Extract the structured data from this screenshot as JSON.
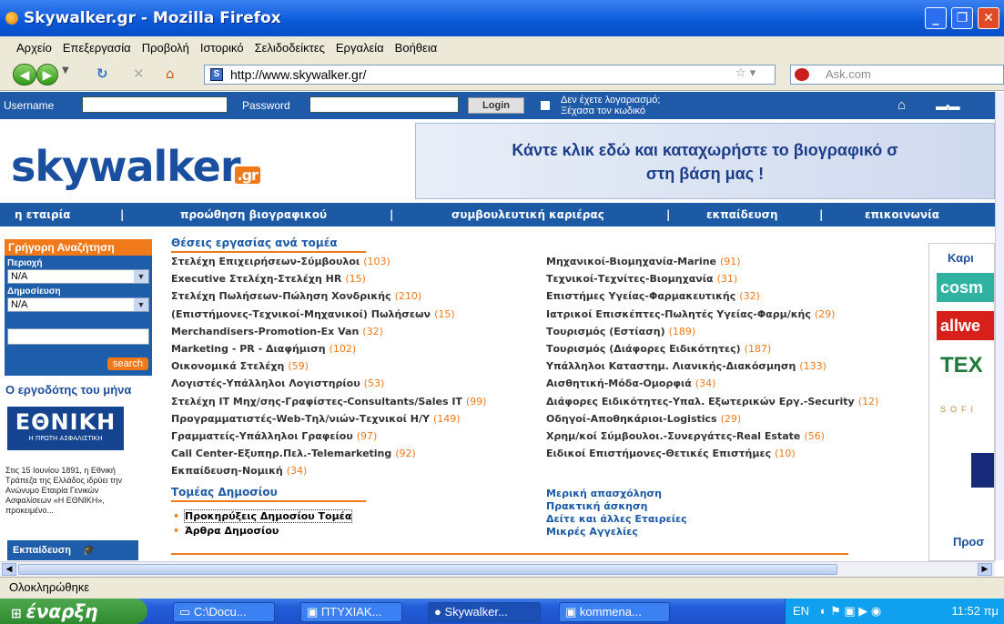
{
  "window": {
    "title": "Skywalker.gr - Mozilla Firefox"
  },
  "menu": [
    "Αρχείο",
    "Επεξεργασία",
    "Προβολή",
    "Ιστορικό",
    "Σελιδοδείκτες",
    "Εργαλεία",
    "Βοήθεια"
  ],
  "nav": {
    "url": "http://www.skywalker.gr/",
    "search_engine": "Ask.com"
  },
  "site_top": {
    "username_label": "Username",
    "password_label": "Password",
    "login_label": "Login",
    "no_account": "Δεν έχετε λογαριασμό;",
    "forgot": "Ξέχασα τον κωδικό"
  },
  "header": {
    "logo": "skywalker",
    "logo_suffix": ".gr",
    "banner_line1": "Κάντε κλικ εδώ και καταχωρήστε το βιογραφικό σ",
    "banner_line2": "στη βάση μας !"
  },
  "mainnav": [
    "η εταιρία",
    "προώθηση βιογραφικού",
    "συμβουλευτική καριέρας",
    "εκπαίδευση",
    "επικοινωνία"
  ],
  "quick_search": {
    "title": "Γρήγορη Αναζήτηση",
    "region_label": "Περιοχή",
    "region_value": "N/A",
    "published_label": "Δημοσίευση",
    "published_value": "N/A",
    "search_button": "search"
  },
  "employer": {
    "title": "Ο εργοδότης του μήνα",
    "logo_main": "ΕΘΝΙΚΗ",
    "logo_sub": "Η ΠΡΩΤΗ ΑΣΦΑΛΙΣΤΙΚΗ",
    "text": "Στις 15 Ιουνίου 1891, η Εθνική Τράπεζα της Ελλάδος ιδρύει την Ανώνυμο Εταιρία Γενικών Ασφαλίσεων «Η ΕΘΝΙΚΗ», προκειμένο..."
  },
  "education_box": "Εκπαίδευση",
  "jobs": {
    "title": "Θέσεις εργασίας ανά τομέα",
    "left": [
      {
        "label": "Στελέχη Επιχειρήσεων-Σύμβουλοι",
        "count": "(103)"
      },
      {
        "label": "Executive Στελέχη-Στελέχη HR",
        "count": "(15)"
      },
      {
        "label": "Στελέχη Πωλήσεων-Πώληση Χονδρικής",
        "count": "(210)"
      },
      {
        "label": "(Επιστήμονες-Τεχνικοί-Μηχανικοί) Πωλήσεων",
        "count": "(15)"
      },
      {
        "label": "Merchandisers-Promotion-Ex Van",
        "count": "(32)"
      },
      {
        "label": "Marketing - PR - Διαφήμιση",
        "count": "(102)"
      },
      {
        "label": "Οικονομικά Στελέχη",
        "count": "(59)"
      },
      {
        "label": "Λογιστές-Υπάλληλοι Λογιστηρίου",
        "count": "(53)"
      },
      {
        "label": "Στελέχη IT Μηχ/σης-Γραφίστες-Consultants/Sales IT",
        "count": "(99)"
      },
      {
        "label": "Προγραμματιστές-Web-Τηλ/νιών-Τεχνικοί Η/Υ",
        "count": "(149)"
      },
      {
        "label": "Γραμματείς-Υπάλληλοι Γραφείου",
        "count": "(97)"
      },
      {
        "label": "Call Center-Εξυπηρ.Πελ.-Telemarketing",
        "count": "(92)"
      },
      {
        "label": "Εκπαίδευση-Νομική",
        "count": "(34)"
      }
    ],
    "right": [
      {
        "label": "Μηχανικοί-Βιομηχανία-Marine",
        "count": "(91)"
      },
      {
        "label": "Τεχνικοί-Τεχνίτες-Βιομηχανία",
        "count": "(31)"
      },
      {
        "label": "Επιστήμες Υγείας-Φαρμακευτικής",
        "count": "(32)"
      },
      {
        "label": "Ιατρικοί Επισκέπτες-Πωλητές Υγείας-Φαρμ/κής",
        "count": "(29)"
      },
      {
        "label": "Τουρισμός (Εστίαση)",
        "count": "(189)"
      },
      {
        "label": "Τουρισμός (Διάφορες Ειδικότητες)",
        "count": "(187)"
      },
      {
        "label": "Υπάλληλοι Καταστημ. Λιανικής-Διακόσμηση",
        "count": "(133)"
      },
      {
        "label": "Αισθητική-Μόδα-Ομορφιά",
        "count": "(34)"
      },
      {
        "label": "Διάφορες Ειδικότητες-Υπαλ. Εξωτερικών Εργ.-Security",
        "count": "(12)"
      },
      {
        "label": "Οδηγοί-Αποθηκάριοι-Logistics",
        "count": "(29)"
      },
      {
        "label": "Χρημ/κοί Σύμβουλοι.-Συνεργάτες-Real Estate",
        "count": "(56)"
      },
      {
        "label": "Ειδικοί Επιστήμονες-Θετικές Επιστήμες",
        "count": "(10)"
      }
    ]
  },
  "public_sector": {
    "title": "Τομέας Δημοσίου",
    "items": [
      "Προκηρύξεις Δημοσίου Τομέα",
      "Άρθρα Δημοσίου"
    ]
  },
  "other_links": [
    "Μερική απασχόληση",
    "Πρακτική άσκηση",
    "Δείτε και άλλες Εταιρείες",
    "Μικρές Αγγελίες"
  ],
  "right_col": {
    "title": "Καρι",
    "logos": [
      "cosm",
      "allwe",
      "TEX"
    ],
    "sofi": "SOFI",
    "bottom_title": "Προσ"
  },
  "status": "Ολοκληρώθηκε",
  "taskbar": {
    "start": "έναρξη",
    "items": [
      "C:\\Docu...",
      "ΠΤΥΧΙΑΚ...",
      "Skywalker...",
      "kommena..."
    ],
    "lang": "EN",
    "clock": "11:52 πμ"
  },
  "colors": {
    "brand_blue": "#1d5aa6",
    "accent_orange": "#f07a1a"
  }
}
